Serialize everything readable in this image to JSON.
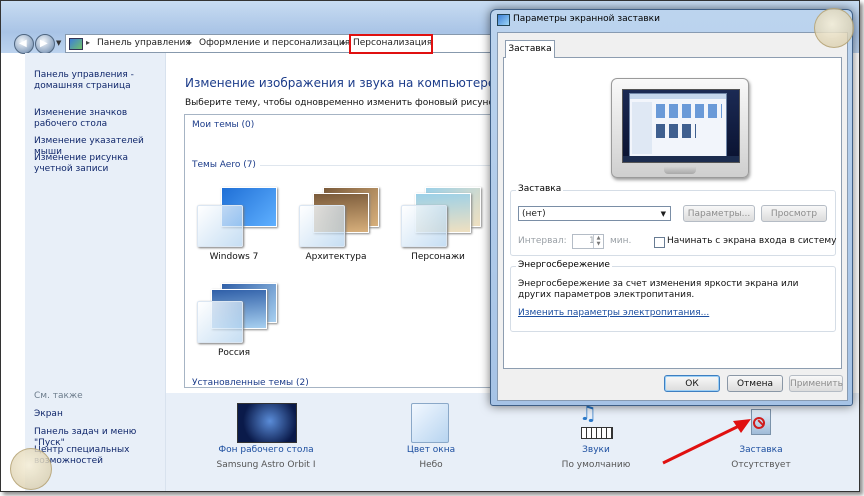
{
  "explorer": {
    "breadcrumbs": [
      "Панель управления",
      "Оформление и персонализация",
      "Персонализация"
    ],
    "sidebar": {
      "links": [
        "Панель управления - домашняя страница",
        "Изменение значков рабочего стола",
        "Изменение указателей мыши",
        "Изменение рисунка учетной записи"
      ],
      "see_also_title": "См. также",
      "see_also": [
        "Экран",
        "Панель задач и меню \"Пуск\"",
        "Центр специальных возможностей"
      ]
    },
    "content": {
      "title": "Изменение изображения и звука на компьютере",
      "subtitle": "Выберите тему, чтобы одновременно изменить фоновый рисунок рабо",
      "groups": {
        "my_themes": "Мои темы (0)",
        "aero_themes": "Темы Aero (7)",
        "installed_themes": "Установленные темы (2)"
      },
      "themes": [
        {
          "name": "Windows 7",
          "color_a": "#1f6fd6",
          "color_b": "#5fb0ff"
        },
        {
          "name": "Архитектура",
          "color_a": "#7a5a3a",
          "color_b": "#d8b07c"
        },
        {
          "name": "Персонажи",
          "color_a": "#9bd0e8",
          "color_b": "#f0e0c0"
        },
        {
          "name": "Россия",
          "color_a": "#2f5fa8",
          "color_b": "#a8d0f0"
        }
      ]
    },
    "bottom": [
      {
        "label": "Фон рабочего стола",
        "value": "Samsung Astro Orbit I",
        "icon": "desktop-background-icon"
      },
      {
        "label": "Цвет окна",
        "value": "Небо",
        "icon": "window-color-icon"
      },
      {
        "label": "Звуки",
        "value": "По умолчанию",
        "icon": "sounds-icon"
      },
      {
        "label": "Заставка",
        "value": "Отсутствует",
        "icon": "screensaver-icon"
      }
    ]
  },
  "dialog": {
    "title": "Параметры экранной заставки",
    "tab": "Заставка",
    "screensaver_group": "Заставка",
    "screensaver_value": "(нет)",
    "params_button": "Параметры...",
    "preview_button": "Просмотр",
    "interval_label": "Интервал:",
    "interval_value": "1",
    "minutes_label": "мин.",
    "logon_checkbox": "Начинать с экрана входа в систему",
    "power_group": "Энергосбережение",
    "power_text": "Энергосбережение за счет изменения яркости экрана или других параметров электропитания.",
    "power_link": "Изменить параметры электропитания...",
    "ok_button": "ОК",
    "cancel_button": "Отмена",
    "apply_button": "Применить"
  },
  "colors": {
    "link": "#1d4fa0",
    "heading": "#1c3c8a",
    "highlight_box": "#e01010",
    "arrow": "#e01010"
  }
}
